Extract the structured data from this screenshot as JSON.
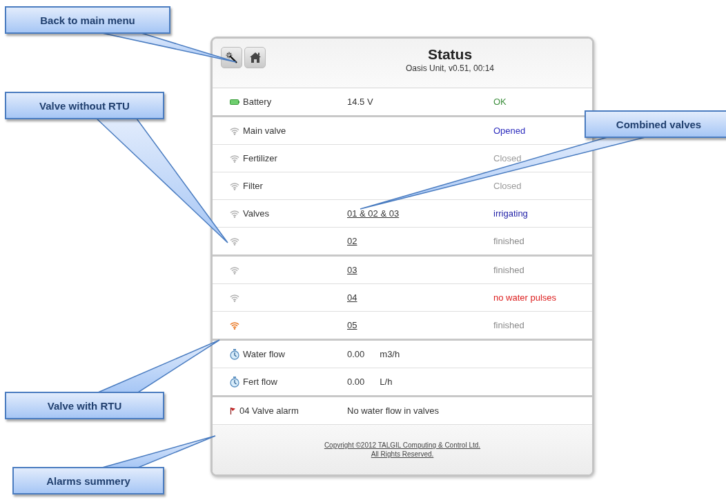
{
  "header": {
    "title": "Status",
    "subtitle": "Oasis Unit, v0.51, 00:14"
  },
  "sections": [
    {
      "rows": [
        {
          "kind": "battery",
          "label": "Battery",
          "value": "14.5 V",
          "value_link": false,
          "status": {
            "text": "OK",
            "color": "#3d8f3d"
          }
        }
      ]
    },
    {
      "rows": [
        {
          "kind": "wifi",
          "rtu": false,
          "label": "Main valve",
          "status": {
            "text": "Opened",
            "color": "#2b2bbd"
          }
        },
        {
          "kind": "wifi",
          "rtu": false,
          "label": "Fertilizer",
          "status": {
            "text": "Closed",
            "color": "#9a9a9a"
          }
        },
        {
          "kind": "wifi",
          "rtu": false,
          "label": "Filter",
          "status": {
            "text": "Closed",
            "color": "#9a9a9a"
          }
        },
        {
          "kind": "wifi",
          "rtu": false,
          "label": "Valves",
          "value": "01 & 02 & 03",
          "value_link": true,
          "status": {
            "text": "irrigating",
            "color": "#2323a8"
          }
        },
        {
          "kind": "wifi",
          "rtu": false,
          "value": "02",
          "value_link": true,
          "status": {
            "text": "finished",
            "color": "#8a8a8a"
          }
        }
      ]
    },
    {
      "rows": [
        {
          "kind": "wifi",
          "rtu": false,
          "value": "03",
          "value_link": true,
          "status": {
            "text": "finished",
            "color": "#8a8a8a"
          }
        },
        {
          "kind": "wifi",
          "rtu": false,
          "value": "04",
          "value_link": true,
          "status": {
            "text": "no water pulses",
            "color": "#dd2020"
          }
        },
        {
          "kind": "wifi",
          "rtu": true,
          "value": "05",
          "value_link": true,
          "status": {
            "text": "finished",
            "color": "#8a8a8a"
          }
        }
      ]
    },
    {
      "rows": [
        {
          "kind": "timer",
          "label": "Water flow",
          "value": "0.00",
          "value_link": false,
          "unit": "m3/h"
        },
        {
          "kind": "timer",
          "label": "Fert flow",
          "value": "0.00",
          "value_link": false,
          "unit": "L/h"
        }
      ]
    },
    {
      "rows": [
        {
          "kind": "flag",
          "label": "04 Valve alarm",
          "value": "No water flow in valves",
          "value_link": false
        }
      ]
    }
  ],
  "footer": {
    "lines": [
      "Copyright ©2012 TALGIL Computing & Control Ltd.",
      "All Rights Reserved."
    ]
  },
  "callouts": [
    {
      "text": "Back to main menu"
    },
    {
      "text": "Valve without RTU"
    },
    {
      "text": "Combined valves"
    },
    {
      "text": "Valve with RTU"
    },
    {
      "text": "Alarms summery"
    }
  ]
}
